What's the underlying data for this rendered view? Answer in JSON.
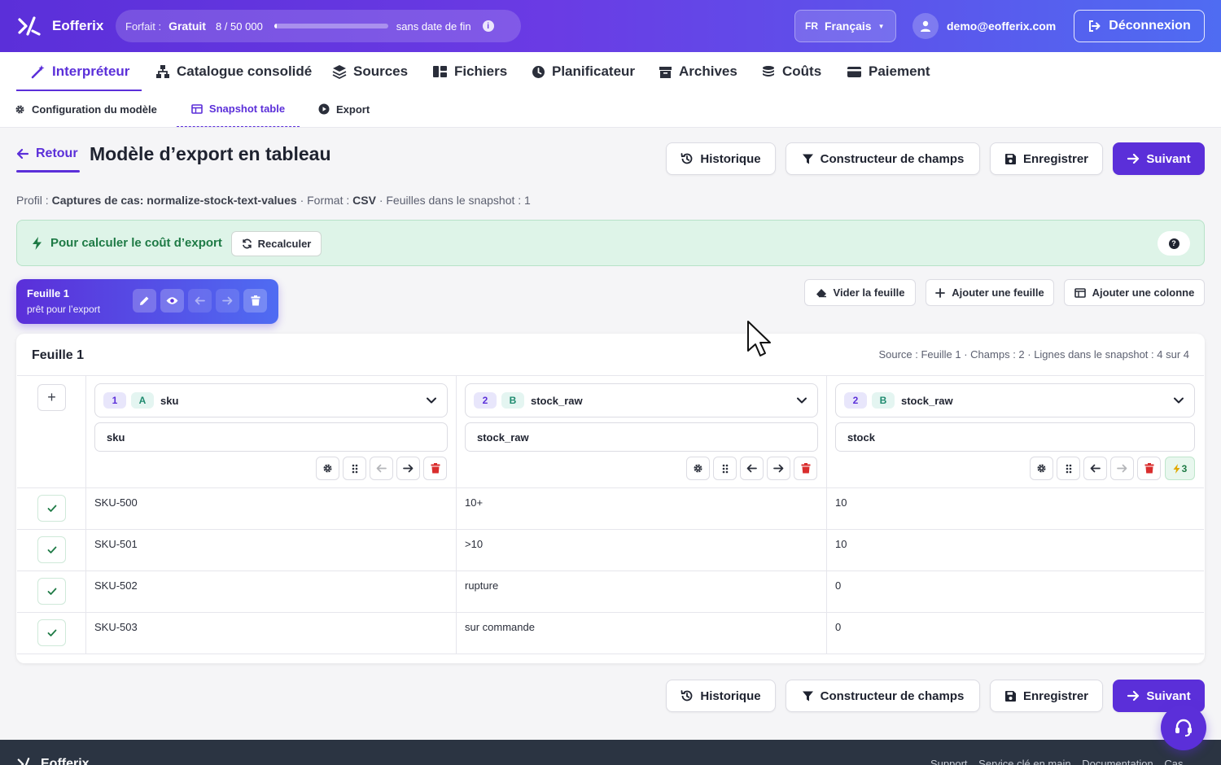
{
  "app": {
    "name": "Eofferix"
  },
  "plan": {
    "label": "Forfait :",
    "tier": "Gratuit",
    "usage": "8 / 50 000",
    "usage_fraction": 0.00016,
    "no_end": "sans date de fin",
    "info": "i"
  },
  "lang": {
    "code": "FR",
    "name": "Français"
  },
  "user": {
    "email": "demo@eofferix.com"
  },
  "logout": "Déconnexion",
  "nav": [
    {
      "label": "Interpréteur",
      "icon": "magic-wand-icon",
      "active": true
    },
    {
      "label": "Catalogue consolidé",
      "icon": "sitemap-icon"
    },
    {
      "label": "Sources",
      "icon": "layers-icon"
    },
    {
      "label": "Fichiers",
      "icon": "files-icon"
    },
    {
      "label": "Planificateur",
      "icon": "clock-icon"
    },
    {
      "label": "Archives",
      "icon": "archive-icon"
    },
    {
      "label": "Coûts",
      "icon": "coins-icon"
    },
    {
      "label": "Paiement",
      "icon": "credit-card-icon"
    }
  ],
  "subnav": [
    {
      "label": "Configuration du modèle",
      "icon": "gear-icon"
    },
    {
      "label": "Snapshot table",
      "icon": "table-icon",
      "active": true
    },
    {
      "label": "Export",
      "icon": "play-icon"
    }
  ],
  "header": {
    "back": "Retour",
    "title": "Modèle d’export en tableau",
    "history": "Historique",
    "field_builder": "Constructeur de champs",
    "save": "Enregistrer",
    "next": "Suivant"
  },
  "meta": {
    "profile_label": "Profil :",
    "profile": "Captures de cas: normalize-stock-text-values",
    "sep1": " · Format : ",
    "format": "CSV",
    "sheets": " · Feuilles dans le snapshot : 1"
  },
  "cost": {
    "text": "Pour calculer le coût d’export",
    "recalc": "Recalculer",
    "help": "?"
  },
  "sheet_chip": {
    "title": "Feuille 1",
    "status": "prêt pour l’export"
  },
  "sheet_actions": {
    "clear": "Vider la feuille",
    "add_sheet": "Ajouter une feuille",
    "add_column": "Ajouter une colonne"
  },
  "table": {
    "title": "Feuille 1",
    "meta": "Source : Feuille 1 · Champs : 2 · Lignes dans le snapshot : 4 sur 4",
    "add": "+",
    "columns": [
      {
        "num": "1",
        "letter": "A",
        "field": "sku",
        "name": "sku"
      },
      {
        "num": "2",
        "letter": "B",
        "field": "stock_raw",
        "name": "stock_raw"
      },
      {
        "num": "2",
        "letter": "B",
        "field": "stock_raw",
        "name": "stock",
        "rules": "3"
      }
    ],
    "rows": [
      [
        "SKU-500",
        "10+",
        "10"
      ],
      [
        "SKU-501",
        ">10",
        "10"
      ],
      [
        "SKU-502",
        "rupture",
        "0"
      ],
      [
        "SKU-503",
        "sur commande",
        "0"
      ]
    ]
  },
  "footer": {
    "brand": "Eofferix",
    "links": [
      "Support",
      "Service clé en main",
      "Documentation",
      "Cas"
    ]
  },
  "colors": {
    "accent": "#5b2fd9",
    "accent2": "#4f6cf2",
    "success": "#1e7a45",
    "danger": "#d92d2d"
  }
}
